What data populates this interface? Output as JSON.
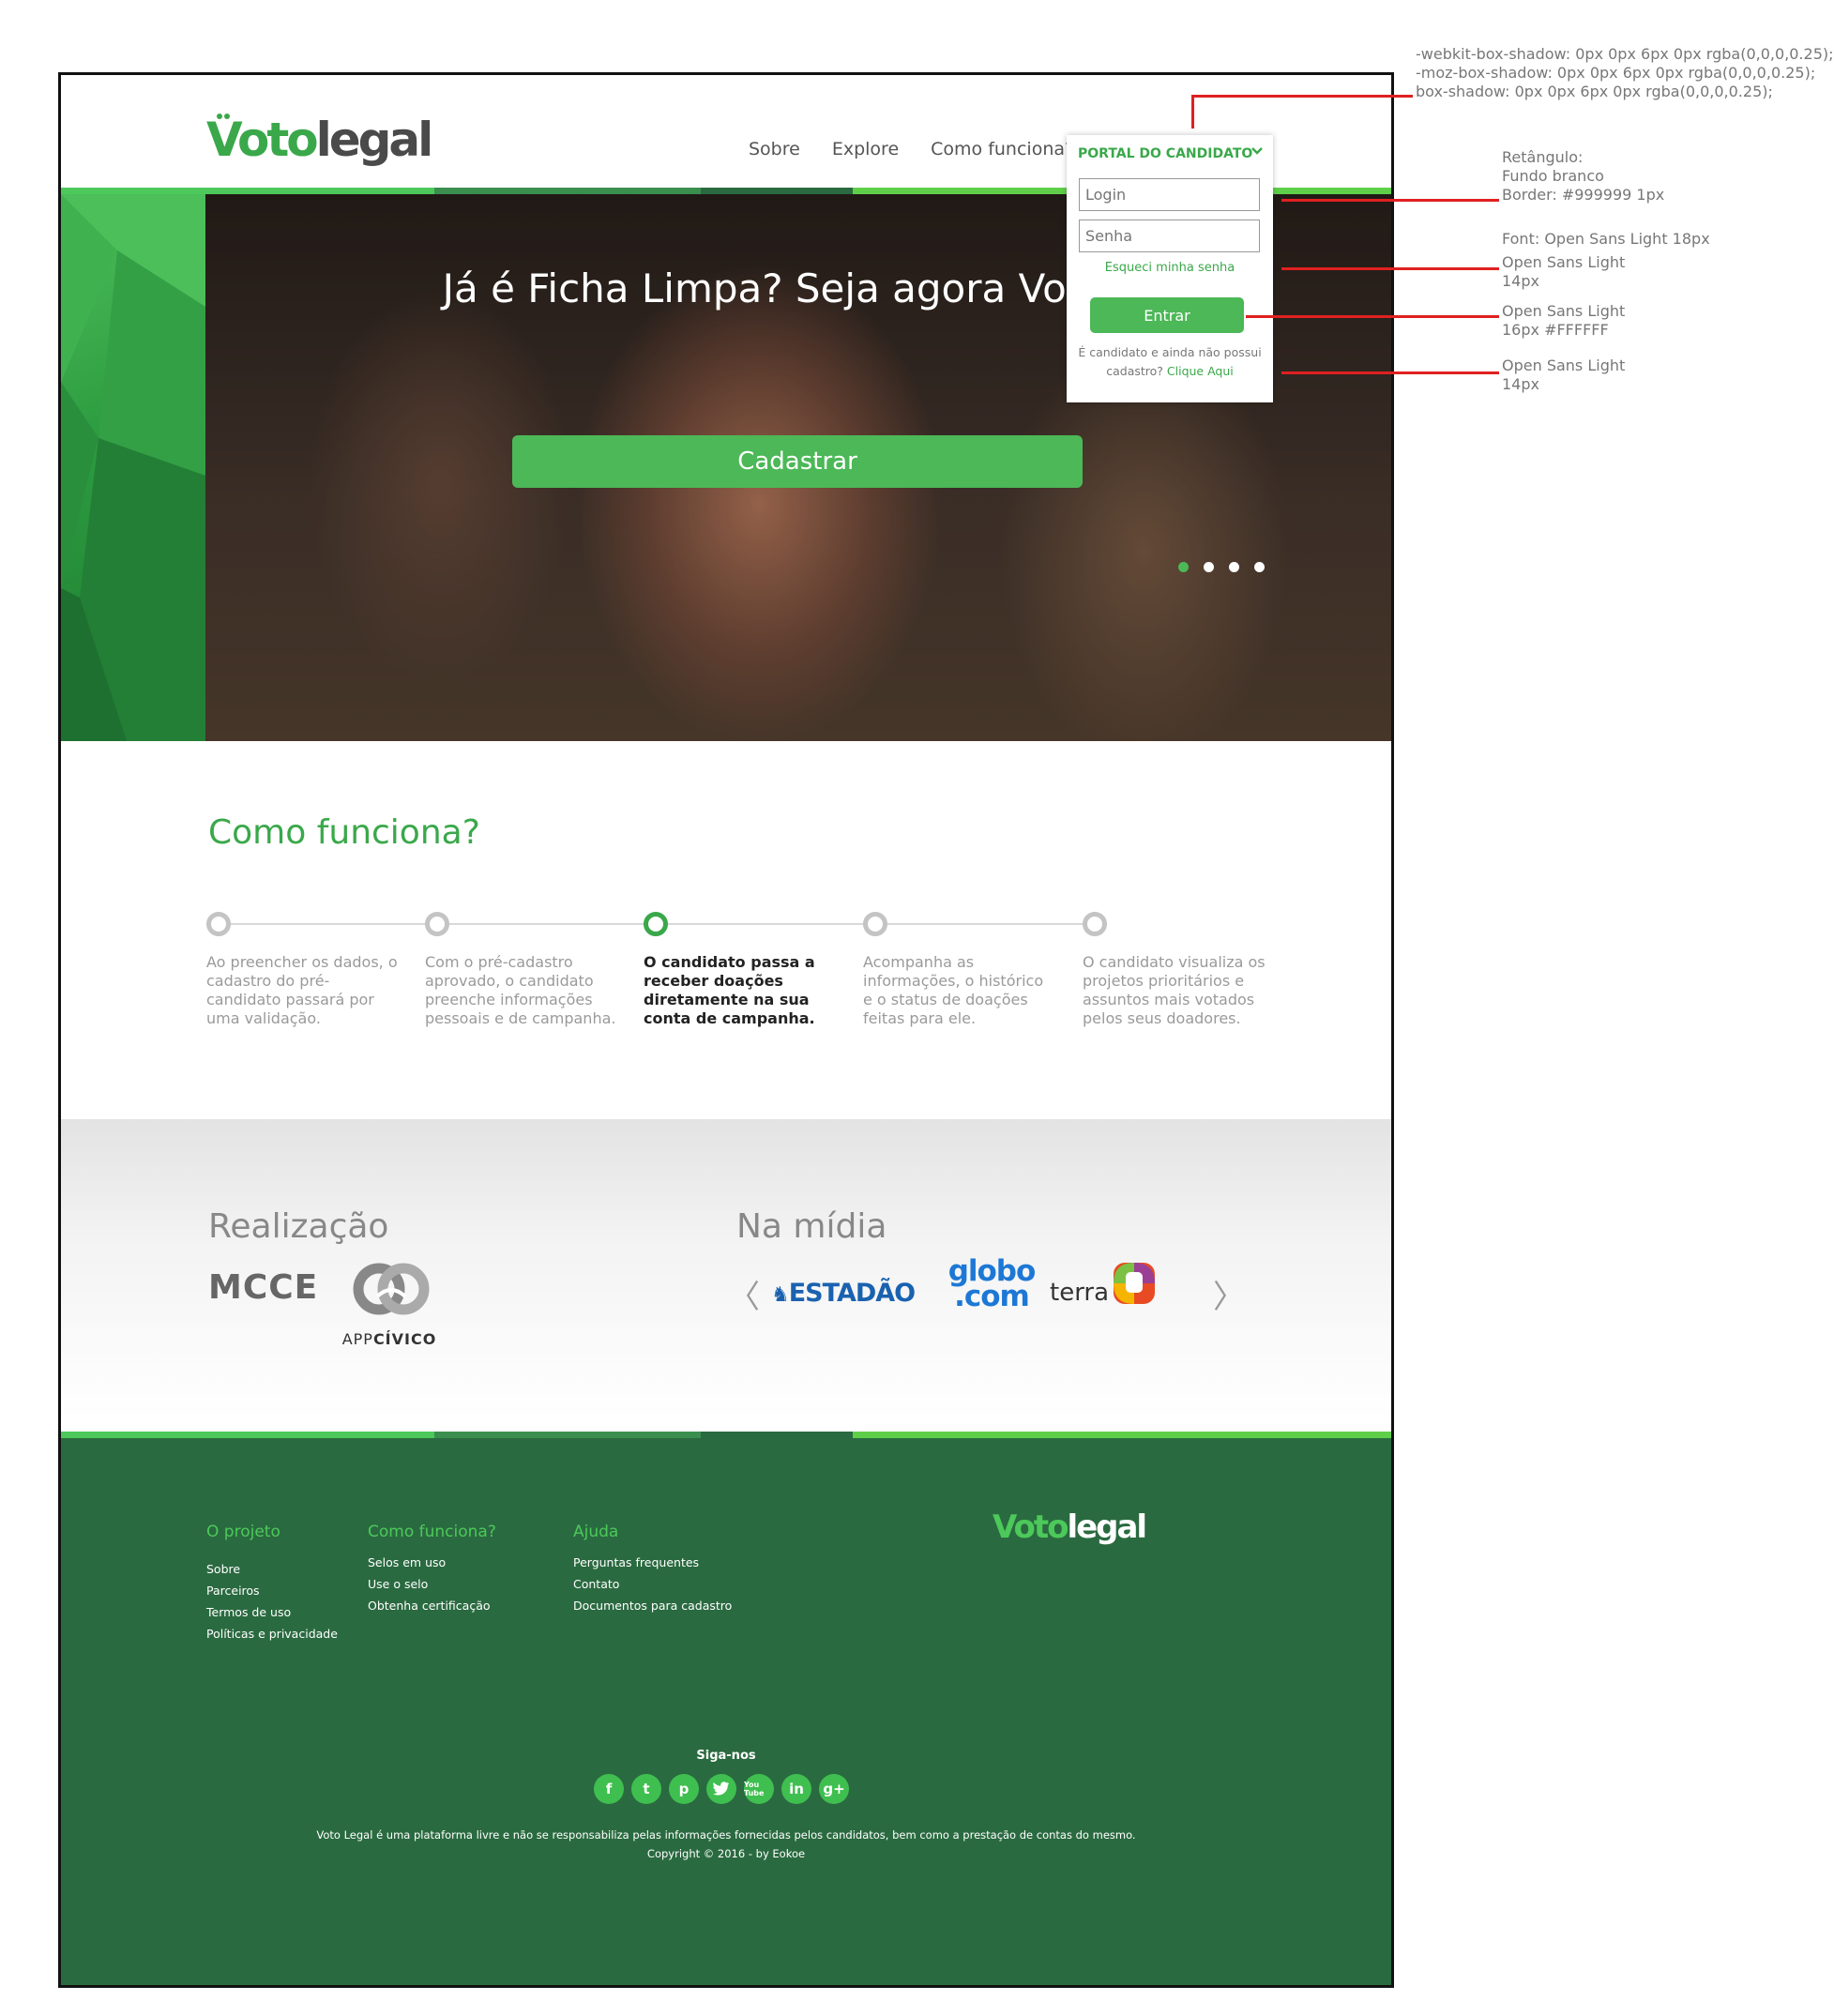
{
  "brand": {
    "logo_part1": "Voto",
    "logo_part2": "legal"
  },
  "nav": {
    "items": [
      "Sobre",
      "Explore",
      "Como funciona?"
    ]
  },
  "portal": {
    "title": "PORTAL DO CANDIDATO",
    "login_placeholder": "Login",
    "password_placeholder": "Senha",
    "forgot": "Esqueci minha senha",
    "submit": "Entrar",
    "not_candidate": "É candidato e ainda não possui cadastro?",
    "click_here": "Clique Aqui"
  },
  "hero": {
    "title": "Já é Ficha Limpa? Seja agora VotoLegal!",
    "cta": "Cadastrar",
    "slides": 4,
    "active_slide": 1
  },
  "how": {
    "title": "Como funciona?",
    "active_step": 3,
    "steps": [
      "Ao preencher os dados, o cadastro do pré-candidato passará por uma validação.",
      "Com o pré-cadastro aprovado, o candidato preenche informações pessoais e de campanha.",
      "O candidato passa a receber doações diretamente na sua conta de campanha.",
      "Acompanha as informações, o histórico e o status de doações feitas para ele.",
      "O candidato visualiza os projetos prioritários e assuntos mais votados pelos seus doadores."
    ]
  },
  "partners": {
    "realizacao_title": "Realização",
    "midia_title": "Na mídia",
    "mcce": "MCCE",
    "appcivico_a": "APP",
    "appcivico_b": "CÍVICO",
    "media": {
      "estadao": "ESTADÃO",
      "globo_1": "globo",
      "globo_2": ".com",
      "terra": "terra"
    },
    "prev": "〈",
    "next": "〉"
  },
  "footer": {
    "col1": {
      "title": "O projeto",
      "items": [
        "Sobre",
        "Parceiros",
        "Termos de uso",
        "Políticas e privacidade"
      ]
    },
    "col2": {
      "title": "Como funciona?",
      "items": [
        "Selos em uso",
        "Use o selo",
        "Obtenha certificação"
      ]
    },
    "col3": {
      "title": "Ajuda",
      "items": [
        "Perguntas frequentes",
        "Contato",
        "Documentos para cadastro"
      ]
    },
    "follow": "Siga-nos",
    "socials": [
      "f",
      "t",
      "p",
      "twitter",
      "You Tube",
      "in",
      "g+"
    ],
    "disclaimer": "Voto Legal é uma plataforma livre e não se responsabiliza pelas informações fornecidas pelos candidatos, bem como a prestação de contas do mesmo.",
    "copyright": "Copyright © 2016 - by Eokoe"
  },
  "annotations": {
    "shadow_1": "-webkit-box-shadow: 0px 0px 6px 0px rgba(0,0,0,0.25);",
    "shadow_2": "-moz-box-shadow: 0px 0px 6px 0px rgba(0,0,0,0.25);",
    "shadow_3": "box-shadow: 0px 0px 6px 0px rgba(0,0,0,0.25);",
    "rect_1": "Retângulo:",
    "rect_2": "Fundo branco",
    "rect_3": "Border: #999999 1px",
    "font_1": "Font: Open Sans Light 18px",
    "forgot_1": "Open Sans Light",
    "forgot_2": "14px",
    "btn_1": "Open Sans Light",
    "btn_2": "16px #FFFFFF",
    "info_1": "Open Sans Light",
    "info_2": "14px"
  },
  "colors": {
    "brand_green": "#3aa84a",
    "button_green": "#4cb857",
    "footer_green": "#2a6a40",
    "strip": [
      "#4cc95a",
      "#3a8f4f",
      "#2a6a40",
      "#2a6a40",
      "#5fcf4a"
    ]
  }
}
